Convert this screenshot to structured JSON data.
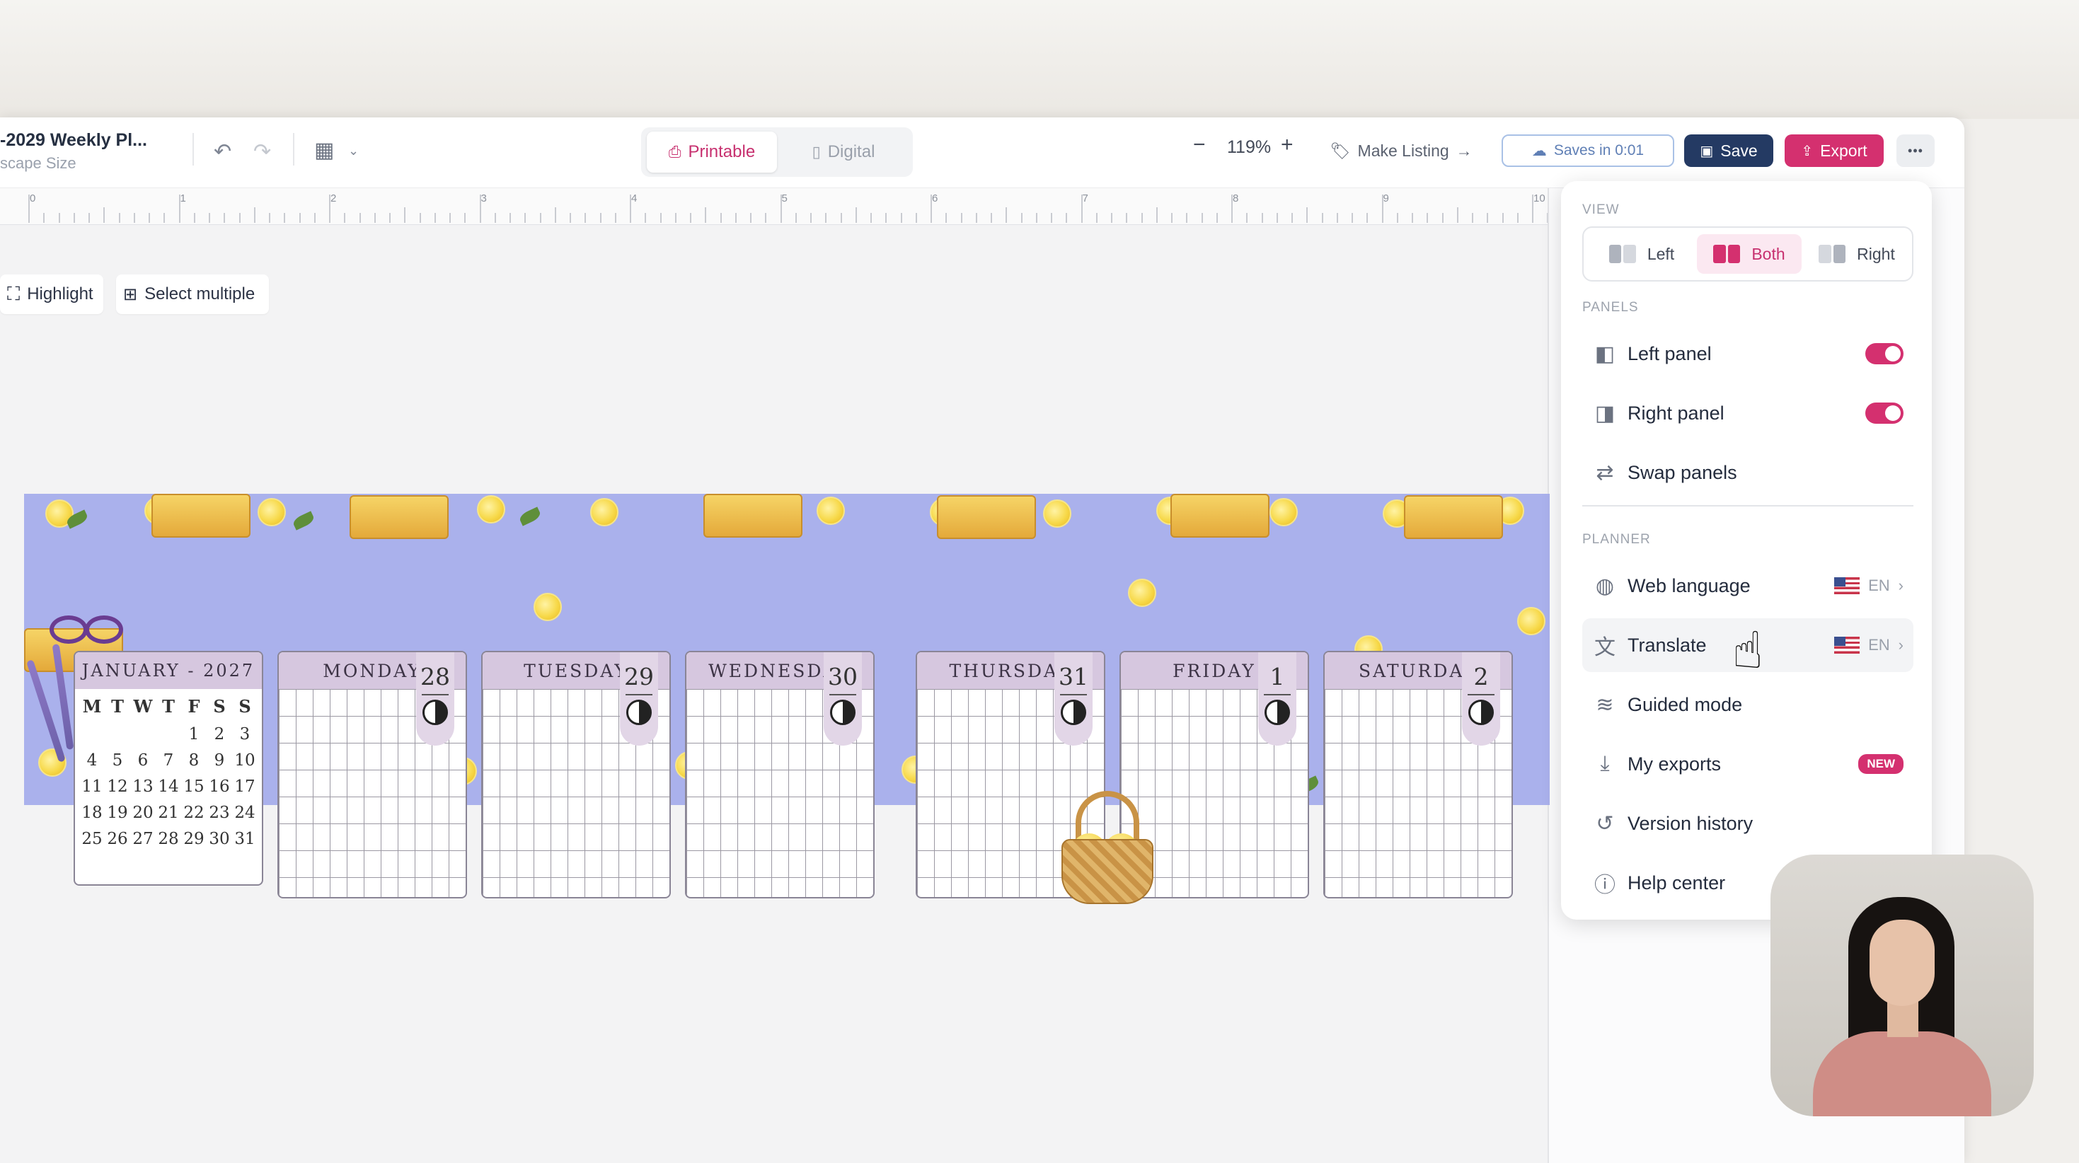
{
  "toolbar": {
    "doc_title": "-2029 Weekly Pl...",
    "doc_subtitle": "scape Size",
    "mode_printable": "Printable",
    "mode_digital": "Digital",
    "zoom_minus": "−",
    "zoom_level": "119%",
    "zoom_plus": "+",
    "make_listing": "Make Listing",
    "saves_in": "Saves in 0:01",
    "save": "Save",
    "export": "Export",
    "more": "•••"
  },
  "colors": {
    "accent": "#d4306f",
    "save_button": "#243a63",
    "planner_bg": "#aab1ec",
    "card_header": "#d6c7df"
  },
  "ruler": {
    "numbers": [
      "0",
      "1",
      "2",
      "3",
      "4",
      "5",
      "6",
      "7",
      "8",
      "9",
      "10"
    ]
  },
  "canvas_tools": {
    "highlight": "Highlight",
    "select_multiple": "Select multiple"
  },
  "planner": {
    "month_title": "JANUARY - 2027",
    "dows": [
      "M",
      "T",
      "W",
      "T",
      "F",
      "S",
      "S"
    ],
    "weeks": [
      [
        "",
        "",
        "",
        "",
        "1",
        "2",
        "3"
      ],
      [
        "4",
        "5",
        "6",
        "7",
        "8",
        "9",
        "10"
      ],
      [
        "11",
        "12",
        "13",
        "14",
        "15",
        "16",
        "17"
      ],
      [
        "18",
        "19",
        "20",
        "21",
        "22",
        "23",
        "24"
      ],
      [
        "25",
        "26",
        "27",
        "28",
        "29",
        "30",
        "31"
      ]
    ],
    "days": [
      {
        "name": "MONDAY",
        "date": "28"
      },
      {
        "name": "TUESDAY",
        "date": "29"
      },
      {
        "name": "WEDNESDAY",
        "date": "30"
      },
      {
        "name": "THURSDAY",
        "date": "31"
      },
      {
        "name": "FRIDAY",
        "date": "1"
      },
      {
        "name": "SATURDAY",
        "date": "2"
      }
    ]
  },
  "menu": {
    "view_section": "VIEW",
    "view_left": "Left",
    "view_both": "Both",
    "view_right": "Right",
    "panels_section": "PANELS",
    "left_panel": "Left panel",
    "right_panel": "Right panel",
    "swap_panels": "Swap panels",
    "planner_section": "PLANNER",
    "web_language": "Web language",
    "web_language_value": "EN",
    "translate": "Translate",
    "translate_value": "EN",
    "guided_mode": "Guided mode",
    "my_exports": "My exports",
    "new_badge": "NEW",
    "version_history": "Version history",
    "help_center": "Help center"
  }
}
